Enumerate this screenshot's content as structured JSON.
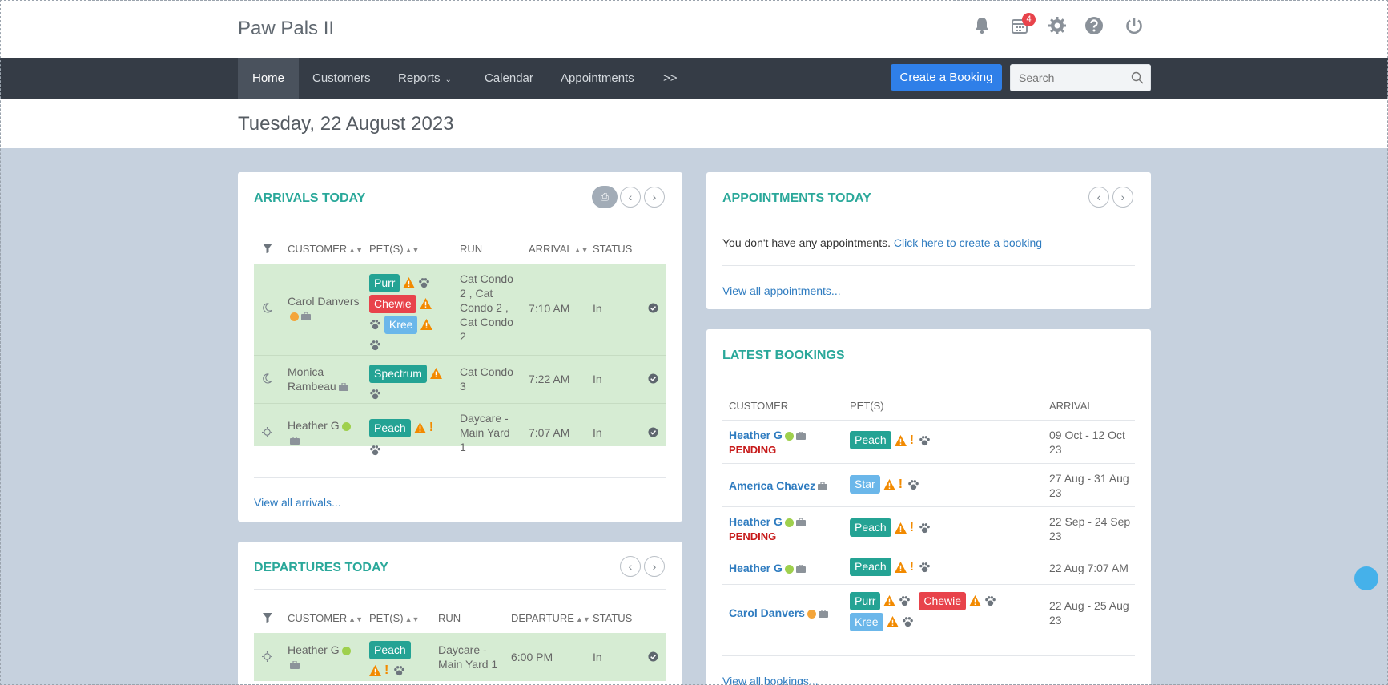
{
  "app": {
    "title": "Paw Pals II",
    "notification_count": "4"
  },
  "top_icons": [
    "bell-icon",
    "calendar-icon",
    "gear-icon",
    "help-icon",
    "power-icon"
  ],
  "nav": {
    "items": [
      "Home",
      "Customers",
      "Reports",
      "Calendar",
      "Appointments",
      ">>"
    ],
    "active": "Home"
  },
  "create_booking": "Create a Booking",
  "search": {
    "placeholder": "Search",
    "value": ""
  },
  "date": "Tuesday, 22 August 2023",
  "arrivals": {
    "title": "ARRIVALS TODAY",
    "headers": [
      "CUSTOMER",
      "PET(S)",
      "RUN",
      "ARRIVAL",
      "STATUS"
    ],
    "rows": [
      {
        "customer": "Carol Danvers",
        "pets": [
          "Purr",
          "Chewie",
          "Kree"
        ],
        "run": "Cat Condo 2 , Cat Condo 2 , Cat Condo 2",
        "arrival": "7:10 AM",
        "status": "In"
      },
      {
        "customer": "Monica Rambeau",
        "pets": [
          "Spectrum"
        ],
        "run": "Cat Condo 3",
        "arrival": "7:22 AM",
        "status": "In"
      },
      {
        "customer": "Heather G",
        "pets": [
          "Peach"
        ],
        "run": "Daycare - Main Yard 1",
        "arrival": "7:07 AM",
        "status": "In"
      }
    ],
    "view_all": "View all arrivals..."
  },
  "departures": {
    "title": "DEPARTURES TODAY",
    "headers": [
      "CUSTOMER",
      "PET(S)",
      "RUN",
      "DEPARTURE",
      "STATUS"
    ],
    "rows": [
      {
        "customer": "Heather G",
        "pets": [
          "Peach"
        ],
        "run": "Daycare - Main Yard 1",
        "departure": "6:00 PM",
        "status": "In"
      }
    ]
  },
  "appointments": {
    "title": "APPOINTMENTS TODAY",
    "empty_text": "You don't have any appointments.",
    "create_link": "Click here to create a booking",
    "view_all": "View all appointments..."
  },
  "latest": {
    "title": "LATEST BOOKINGS",
    "headers": [
      "CUSTOMER",
      "PET(S)",
      "ARRIVAL"
    ],
    "rows": [
      {
        "customer": "Heather G",
        "status": "PENDING",
        "pets": [
          "Peach"
        ],
        "arrival": "09 Oct - 12 Oct 23"
      },
      {
        "customer": "America Chavez",
        "status": "",
        "pets": [
          "Star"
        ],
        "arrival": "27 Aug - 31 Aug 23"
      },
      {
        "customer": "Heather G",
        "status": "PENDING",
        "pets": [
          "Peach"
        ],
        "arrival": "22 Sep - 24 Sep 23"
      },
      {
        "customer": "Heather G",
        "status": "",
        "pets": [
          "Peach"
        ],
        "arrival": "22 Aug 7:07 AM"
      },
      {
        "customer": "Carol Danvers",
        "status": "",
        "pets": [
          "Purr",
          "Chewie",
          "Kree"
        ],
        "arrival": "22 Aug - 25 Aug 23"
      }
    ],
    "view_all": "View all bookings..."
  },
  "colors": {
    "accent": "#2aa89a",
    "nav_bg": "#353c46",
    "primary": "#2f7fe8",
    "row_bg": "#d6ecd3",
    "tag_teal": "#24a394",
    "tag_red": "#e8434b",
    "tag_blue": "#6bb7ea"
  }
}
